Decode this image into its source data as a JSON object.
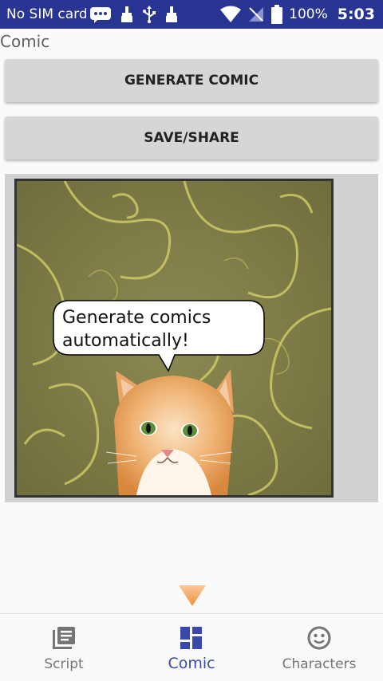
{
  "status_bar": {
    "carrier": "No SIM card",
    "battery": "100%",
    "time": "5:03"
  },
  "page": {
    "title": "Comic"
  },
  "buttons": {
    "generate": "GENERATE COMIC",
    "save_share": "SAVE/SHARE"
  },
  "comic": {
    "speech": "Generate comics automatically!",
    "speech_line1": "Generate comics",
    "speech_line2": "automatically!"
  },
  "bottom_nav": {
    "items": [
      {
        "label": "Script",
        "icon": "list-icon",
        "active": false
      },
      {
        "label": "Comic",
        "icon": "dashboard-icon",
        "active": true
      },
      {
        "label": "Characters",
        "icon": "smiley-icon",
        "active": false
      }
    ]
  },
  "colors": {
    "status_bar": "#283593",
    "accent": "#3949ab",
    "arrow": "#f5a55a"
  }
}
